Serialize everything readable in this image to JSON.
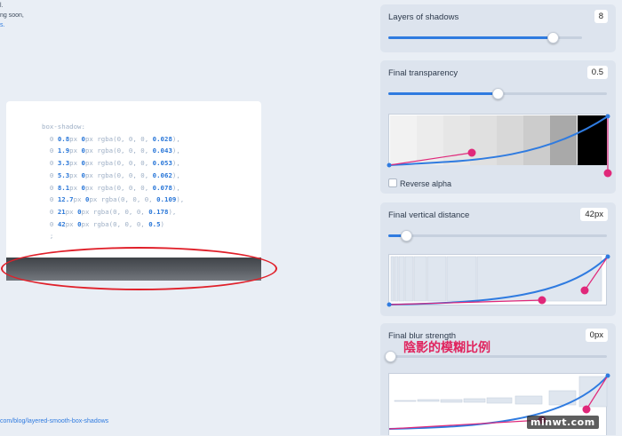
{
  "left": {
    "fragments": [
      "l.",
      "ng soon,",
      "s."
    ],
    "code": {
      "property": "box-shadow:",
      "lines": [
        {
          "a": "0",
          "b": "0.8",
          "c": "0",
          "alpha": "0.028"
        },
        {
          "a": "0",
          "b": "1.9",
          "c": "0",
          "alpha": "0.043"
        },
        {
          "a": "0",
          "b": "3.3",
          "c": "0",
          "alpha": "0.053"
        },
        {
          "a": "0",
          "b": "5.3",
          "c": "0",
          "alpha": "0.062"
        },
        {
          "a": "0",
          "b": "8.1",
          "c": "0",
          "alpha": "0.078"
        },
        {
          "a": "0",
          "b": "12.7",
          "c": "0",
          "alpha": "0.109"
        },
        {
          "a": "0",
          "b": "21",
          "c": "0",
          "alpha": "0.178"
        },
        {
          "a": "0",
          "b": "42",
          "c": "0",
          "alpha": "0.5"
        }
      ],
      "terminator": ";"
    },
    "url": "com/blog/layered-smooth-box-shadows"
  },
  "panels": {
    "layers": {
      "title": "Layers of shadows",
      "value": "8",
      "slider_fraction": 0.85
    },
    "transparency": {
      "title": "Final transparency",
      "value": "0.5",
      "slider_fraction": 0.5,
      "reverse_label": "Reverse alpha"
    },
    "distance": {
      "title": "Final vertical distance",
      "value": "42px",
      "slider_fraction": 0.08
    },
    "blur": {
      "title": "Final blur strength",
      "value": "0px",
      "slider_fraction": 0.0
    }
  },
  "annotation": "陰影的模糊比例",
  "watermark": "minwt.com",
  "colors": {
    "accent": "#2f7be0",
    "handle": "#e0287a",
    "annotation": "#e0245e",
    "oval": "#e0202a"
  }
}
